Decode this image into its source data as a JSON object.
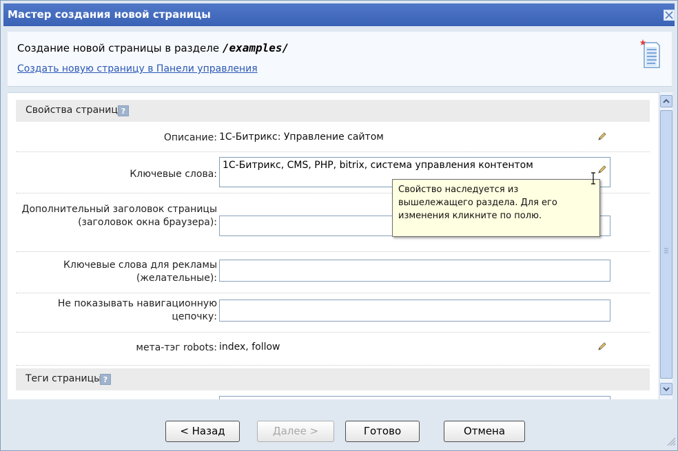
{
  "window": {
    "title": "Мастер создания новой страницы"
  },
  "header": {
    "prefix": "Создание новой страницы в разделе ",
    "path": "/examples/",
    "link": "Создать новую страницу в Панели управления"
  },
  "sections": {
    "properties_title": "Свойства страницы",
    "tags_title": "Теги страницы",
    "help": "?"
  },
  "fields": {
    "description_label": "Описание:",
    "description_value": "1С-Битрикс: Управление сайтом",
    "keywords_label": "Ключевые слова:",
    "keywords_value": "1С-Битрикс, CMS, PHP, bitrix, система управления контентом",
    "title_label": "Дополнительный заголовок страницы (заголовок окна браузера):",
    "title_value": "",
    "ad_keywords_label": "Ключевые слова для рекламы (желательные):",
    "ad_keywords_value": "",
    "hide_nav_label": "Не показывать навигационную цепочку:",
    "hide_nav_value": "",
    "robots_label": "мета-тэг robots:",
    "robots_value": "index, follow"
  },
  "tooltip": {
    "text": "Свойство наследуется из вышележащего раздела. Для его изменения кликните по полю."
  },
  "buttons": {
    "back": "< Назад",
    "next": "Далее >",
    "done": "Готово",
    "cancel": "Отмена"
  }
}
